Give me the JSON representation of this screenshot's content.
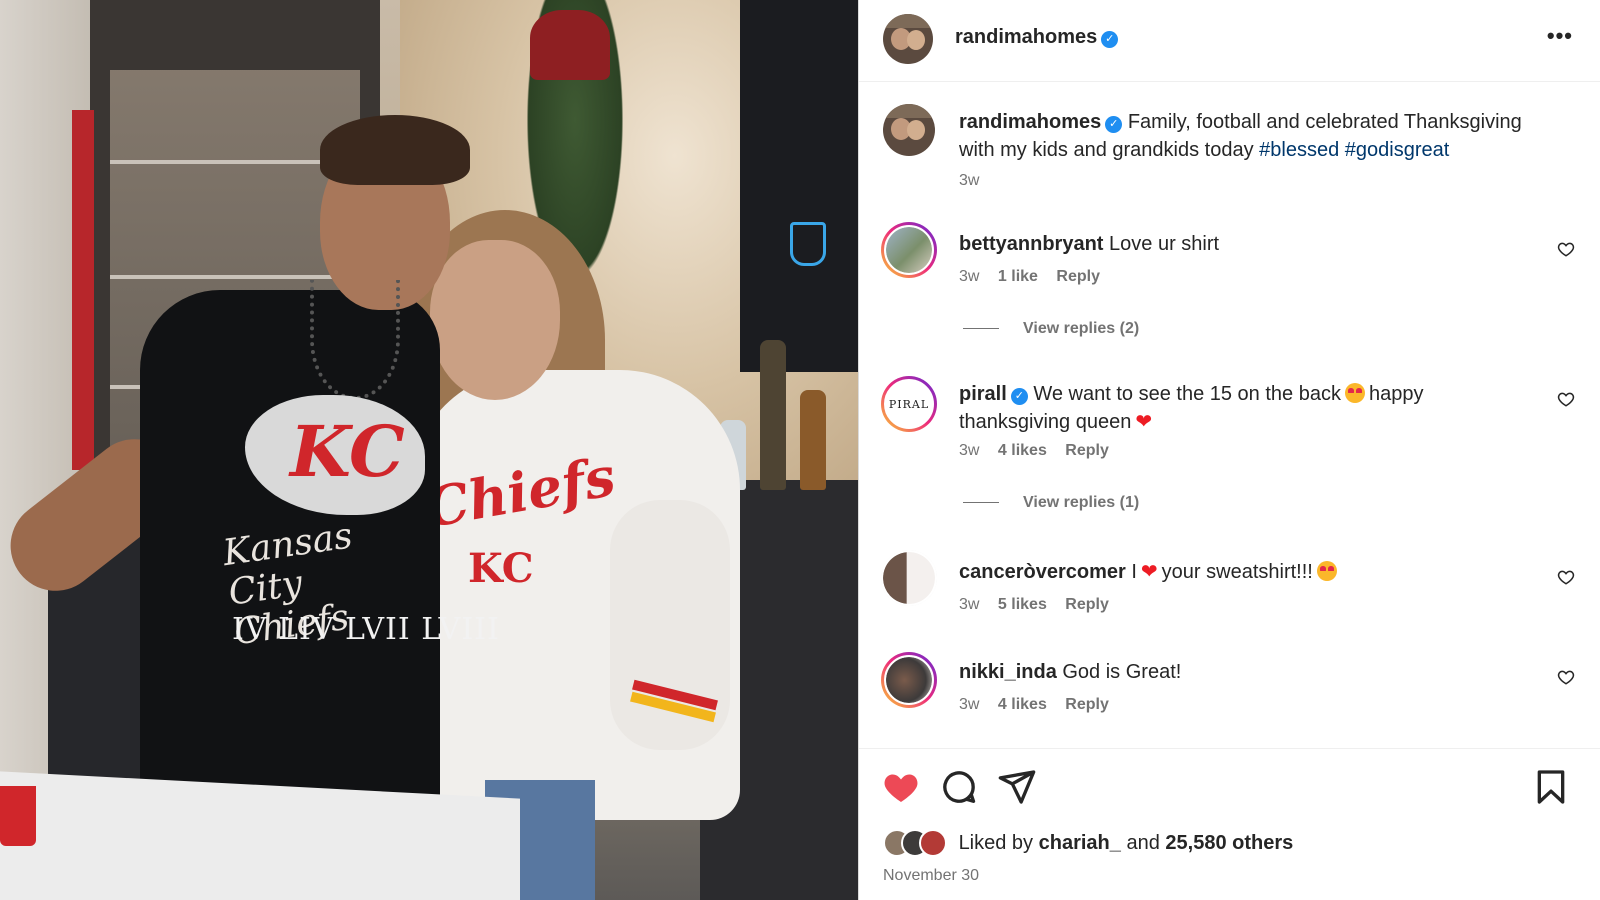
{
  "post": {
    "username": "randimahomes",
    "more_label": "•••",
    "verified_mark": "✓",
    "caption": {
      "username": "randimahomes",
      "text": "Family, football and celebrated Thanksgiving with my kids and grandkids today",
      "hashtags": [
        "#blessed",
        "#godisgreat"
      ],
      "time": "3w"
    },
    "comments": [
      {
        "username": "bettyannbryant",
        "verified": false,
        "text": "Love ur shirt",
        "time": "3w",
        "likes": "1 like",
        "reply": "Reply",
        "view_replies": "View replies (2)"
      },
      {
        "username": "pirall",
        "verified": true,
        "avatar_text": "PIRAL",
        "text_a": "We want to see the 15 on the back",
        "text_b": "happy thanksgiving queen",
        "time": "3w",
        "likes": "4 likes",
        "reply": "Reply",
        "view_replies": "View replies (1)"
      },
      {
        "username": "canceròvercomer",
        "display_username": "canceròvercomer",
        "text_a": "I",
        "text_b": "your sweatshirt!!!",
        "time": "3w",
        "likes": "5 likes",
        "reply": "Reply"
      },
      {
        "username": "nikki_inda",
        "text": "God is Great!",
        "time": "3w",
        "likes": "4 likes",
        "reply": "Reply"
      }
    ],
    "liked_by": {
      "prefix": "Liked by",
      "user": "chariah_",
      "and": "and",
      "others": "25,580 others"
    },
    "date": "November 30",
    "photo": {
      "shirt_team": "Kansas City Chiefs",
      "shirt_numerals": "IV LIV LVII LVIII",
      "kc_mark": "KC",
      "sweatshirt_script": "Chiefs"
    }
  },
  "colors": {
    "like_red": "#ed4956",
    "link_blue": "#00376b",
    "verified_blue": "#1f8ef1",
    "muted": "#737373"
  },
  "icons": [
    "heart-filled-icon",
    "comment-icon",
    "share-icon",
    "bookmark-icon",
    "heart-outline-icon",
    "more-icon",
    "verified-icon"
  ]
}
